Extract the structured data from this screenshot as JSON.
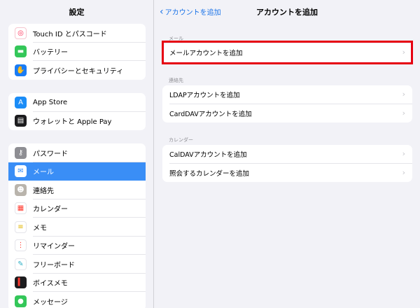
{
  "sidebar": {
    "title": "設定",
    "group1": [
      {
        "label": "Touch ID とパスコード",
        "icon": "fingerprint-icon",
        "color": "#ff2d55",
        "glyph": "◎"
      },
      {
        "label": "バッテリー",
        "icon": "battery-icon",
        "color": "#34c759",
        "glyph": "▬"
      },
      {
        "label": "プライバシーとセキュリティ",
        "icon": "hand-icon",
        "color": "#1a7cf5",
        "glyph": "✋"
      }
    ],
    "group2": [
      {
        "label": "App Store",
        "icon": "app-store-icon",
        "color": "#1a8cf7",
        "glyph": "A"
      },
      {
        "label": "ウォレットと Apple Pay",
        "icon": "wallet-icon",
        "color": "#1c1c1e",
        "glyph": "▤"
      }
    ],
    "group3": [
      {
        "label": "パスワード",
        "icon": "key-icon",
        "color": "#8e8e93",
        "glyph": "⚷"
      },
      {
        "label": "メール",
        "icon": "mail-icon",
        "color": "#1a8cf7",
        "glyph": "✉",
        "active": true
      },
      {
        "label": "連絡先",
        "icon": "contacts-icon",
        "color": "#a8a8a8",
        "glyph": "☻"
      },
      {
        "label": "カレンダー",
        "icon": "calendar-icon",
        "color": "#ff3b30",
        "glyph": "▦"
      },
      {
        "label": "メモ",
        "icon": "notes-icon",
        "color": "#ffcc00",
        "glyph": "≡"
      },
      {
        "label": "リマインダー",
        "icon": "reminders-icon",
        "color": "#5856d6",
        "glyph": "⋮"
      },
      {
        "label": "フリーボード",
        "icon": "freeform-icon",
        "color": "#30b0c7",
        "glyph": "✎"
      },
      {
        "label": "ボイスメモ",
        "icon": "voice-memo-icon",
        "color": "#1c1c1e",
        "glyph": "▍"
      },
      {
        "label": "メッセージ",
        "icon": "messages-icon",
        "color": "#34c759",
        "glyph": "●"
      }
    ]
  },
  "header": {
    "back_label": "アカウントを追加",
    "title": "アカウントを追加"
  },
  "sections": [
    {
      "label": "メール",
      "rows": [
        "メールアカウントを追加"
      ]
    },
    {
      "label": "連絡先",
      "rows": [
        "LDAPアカウントを追加",
        "CardDAVアカウントを追加"
      ]
    },
    {
      "label": "カレンダー",
      "rows": [
        "CalDAVアカウントを追加",
        "照会するカレンダーを追加"
      ]
    }
  ],
  "colors": {
    "accent": "#1a73e8",
    "highlight": "#e60012",
    "active_row": "#3a8ef6"
  }
}
